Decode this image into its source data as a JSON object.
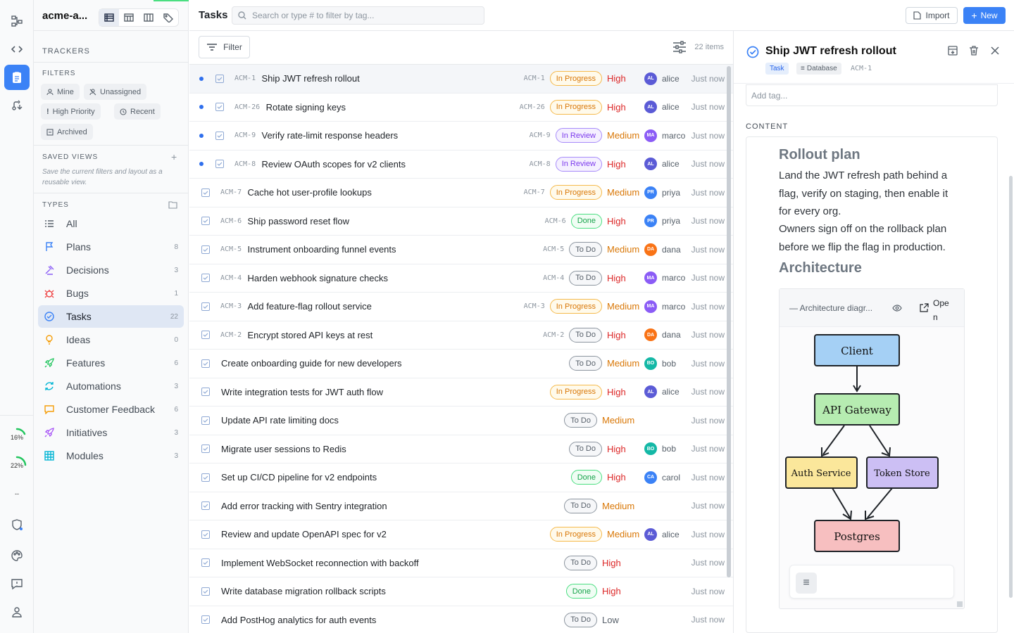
{
  "workspace": {
    "name": "acme-a..."
  },
  "sidebar": {
    "trackers_label": "TRACKERS",
    "filters_label": "FILTERS",
    "filters": [
      {
        "label": "Mine",
        "icon": "user-icon"
      },
      {
        "label": "Unassigned",
        "icon": "user-x-icon"
      },
      {
        "label": "High Priority",
        "icon": "exclamation-icon"
      },
      {
        "label": "Recent",
        "icon": "clock-icon"
      },
      {
        "label": "Archived",
        "icon": "archive-icon"
      }
    ],
    "saved_views_label": "SAVED VIEWS",
    "saved_views_hint": "Save the current filters and layout as a reusable view.",
    "types_label": "TYPES",
    "types": [
      {
        "label": "All",
        "count": "",
        "icon": "list-check-icon",
        "color": "#57606a"
      },
      {
        "label": "Plans",
        "count": "8",
        "icon": "flag-icon",
        "color": "#3b82f6"
      },
      {
        "label": "Decisions",
        "count": "3",
        "icon": "gavel-icon",
        "color": "#8b5cf6"
      },
      {
        "label": "Bugs",
        "count": "1",
        "icon": "bug-icon",
        "color": "#ef4444"
      },
      {
        "label": "Tasks",
        "count": "22",
        "icon": "check-circle-icon",
        "color": "#3b82f6"
      },
      {
        "label": "Ideas",
        "count": "0",
        "icon": "lightbulb-icon",
        "color": "#f59e0b"
      },
      {
        "label": "Features",
        "count": "6",
        "icon": "rocket-icon",
        "color": "#22c55e"
      },
      {
        "label": "Automations",
        "count": "3",
        "icon": "refresh-icon",
        "color": "#06b6d4"
      },
      {
        "label": "Customer Feedback",
        "count": "6",
        "icon": "message-icon",
        "color": "#f59e0b"
      },
      {
        "label": "Initiatives",
        "count": "3",
        "icon": "rocket-icon",
        "color": "#a855f7"
      },
      {
        "label": "Modules",
        "count": "3",
        "icon": "grid-icon",
        "color": "#06b6d4"
      }
    ]
  },
  "rail": {
    "progress": [
      "16%",
      "22%",
      "--"
    ]
  },
  "header": {
    "title": "Tasks",
    "search_placeholder": "Search or type # to filter by tag...",
    "import_label": "Import",
    "new_label": "New"
  },
  "toolbar": {
    "filter_label": "Filter",
    "count": "22 items"
  },
  "tasks": [
    {
      "key": "ACM-1",
      "title": "Ship JWT refresh rollout",
      "rkey": "ACM-1",
      "status": "In Progress",
      "priority": "High",
      "avatar": "AL",
      "avatar_color": "#5b5bd6",
      "user": "alice",
      "when": "Just now",
      "unread": true
    },
    {
      "key": "ACM-26",
      "title": "Rotate signing keys",
      "rkey": "ACM-26",
      "status": "In Progress",
      "priority": "High",
      "avatar": "AL",
      "avatar_color": "#5b5bd6",
      "user": "alice",
      "when": "Just now",
      "unread": true
    },
    {
      "key": "ACM-9",
      "title": "Verify rate-limit response headers",
      "rkey": "ACM-9",
      "status": "In Review",
      "priority": "Medium",
      "avatar": "MA",
      "avatar_color": "#8b5cf6",
      "user": "marco",
      "when": "Just now",
      "unread": true
    },
    {
      "key": "ACM-8",
      "title": "Review OAuth scopes for v2 clients",
      "rkey": "ACM-8",
      "status": "In Review",
      "priority": "High",
      "avatar": "AL",
      "avatar_color": "#5b5bd6",
      "user": "alice",
      "when": "Just now",
      "unread": true
    },
    {
      "key": "ACM-7",
      "title": "Cache hot user-profile lookups",
      "rkey": "ACM-7",
      "status": "In Progress",
      "priority": "Medium",
      "avatar": "PR",
      "avatar_color": "#3b82f6",
      "user": "priya",
      "when": "Just now",
      "unread": false
    },
    {
      "key": "ACM-6",
      "title": "Ship password reset flow",
      "rkey": "ACM-6",
      "status": "Done",
      "priority": "High",
      "avatar": "PR",
      "avatar_color": "#3b82f6",
      "user": "priya",
      "when": "Just now",
      "unread": false
    },
    {
      "key": "ACM-5",
      "title": "Instrument onboarding funnel events",
      "rkey": "ACM-5",
      "status": "To Do",
      "priority": "Medium",
      "avatar": "DA",
      "avatar_color": "#f97316",
      "user": "dana",
      "when": "Just now",
      "unread": false
    },
    {
      "key": "ACM-4",
      "title": "Harden webhook signature checks",
      "rkey": "ACM-4",
      "status": "To Do",
      "priority": "High",
      "avatar": "MA",
      "avatar_color": "#8b5cf6",
      "user": "marco",
      "when": "Just now",
      "unread": false
    },
    {
      "key": "ACM-3",
      "title": "Add feature-flag rollout service",
      "rkey": "ACM-3",
      "status": "In Progress",
      "priority": "Medium",
      "avatar": "MA",
      "avatar_color": "#8b5cf6",
      "user": "marco",
      "when": "Just now",
      "unread": false
    },
    {
      "key": "ACM-2",
      "title": "Encrypt stored API keys at rest",
      "rkey": "ACM-2",
      "status": "To Do",
      "priority": "High",
      "avatar": "DA",
      "avatar_color": "#f97316",
      "user": "dana",
      "when": "Just now",
      "unread": false
    },
    {
      "key": "",
      "title": "Create onboarding guide for new developers",
      "rkey": "",
      "status": "To Do",
      "priority": "Medium",
      "avatar": "BO",
      "avatar_color": "#14b8a6",
      "user": "bob",
      "when": "Just now",
      "unread": false
    },
    {
      "key": "",
      "title": "Write integration tests for JWT auth flow",
      "rkey": "",
      "status": "In Progress",
      "priority": "High",
      "avatar": "AL",
      "avatar_color": "#5b5bd6",
      "user": "alice",
      "when": "Just now",
      "unread": false
    },
    {
      "key": "",
      "title": "Update API rate limiting docs",
      "rkey": "",
      "status": "To Do",
      "priority": "Medium",
      "avatar": "",
      "avatar_color": "",
      "user": "",
      "when": "Just now",
      "unread": false
    },
    {
      "key": "",
      "title": "Migrate user sessions to Redis",
      "rkey": "",
      "status": "To Do",
      "priority": "High",
      "avatar": "BO",
      "avatar_color": "#14b8a6",
      "user": "bob",
      "when": "Just now",
      "unread": false
    },
    {
      "key": "",
      "title": "Set up CI/CD pipeline for v2 endpoints",
      "rkey": "",
      "status": "Done",
      "priority": "High",
      "avatar": "CA",
      "avatar_color": "#3b82f6",
      "user": "carol",
      "when": "Just now",
      "unread": false
    },
    {
      "key": "",
      "title": "Add error tracking with Sentry integration",
      "rkey": "",
      "status": "To Do",
      "priority": "Medium",
      "avatar": "",
      "avatar_color": "",
      "user": "",
      "when": "Just now",
      "unread": false
    },
    {
      "key": "",
      "title": "Review and update OpenAPI spec for v2",
      "rkey": "",
      "status": "In Progress",
      "priority": "Medium",
      "avatar": "AL",
      "avatar_color": "#5b5bd6",
      "user": "alice",
      "when": "Just now",
      "unread": false
    },
    {
      "key": "",
      "title": "Implement WebSocket reconnection with backoff",
      "rkey": "",
      "status": "To Do",
      "priority": "High",
      "avatar": "",
      "avatar_color": "",
      "user": "",
      "when": "Just now",
      "unread": false
    },
    {
      "key": "",
      "title": "Write database migration rollback scripts",
      "rkey": "",
      "status": "Done",
      "priority": "High",
      "avatar": "",
      "avatar_color": "",
      "user": "",
      "when": "Just now",
      "unread": false
    },
    {
      "key": "",
      "title": "Add PostHog analytics for auth events",
      "rkey": "",
      "status": "To Do",
      "priority": "Low",
      "avatar": "",
      "avatar_color": "",
      "user": "",
      "when": "Just now",
      "unread": false
    }
  ],
  "detail": {
    "title": "Ship JWT refresh rollout",
    "tags": [
      "Task",
      "Database",
      "ACM-1"
    ],
    "add_tag_placeholder": "Add tag...",
    "content_label": "CONTENT",
    "heading1": "Rollout plan",
    "para1": "Land the JWT refresh path behind a flag, verify on staging, then enable it for every org.",
    "para2": "Owners sign off on the rollback plan before we flip the flag in production.",
    "heading2": "Architecture",
    "diagram_label": "— Architecture diagr...",
    "open_label": "Ope n",
    "diagram_nodes": [
      "Client",
      "API Gateway",
      "Auth Service",
      "Token Store",
      "Postgres"
    ]
  },
  "colors": {
    "accent": "#3b82f6",
    "high": "#dc2626",
    "medium": "#d97706"
  }
}
